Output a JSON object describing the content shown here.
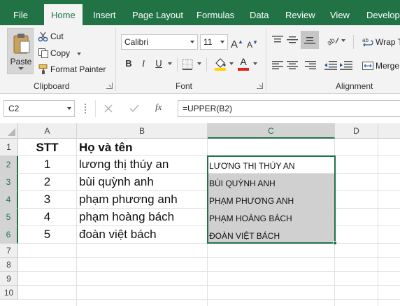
{
  "tabs": [
    {
      "label": "File",
      "active": false
    },
    {
      "label": "Home",
      "active": true
    },
    {
      "label": "Insert",
      "active": false
    },
    {
      "label": "Page Layout",
      "active": false
    },
    {
      "label": "Formulas",
      "active": false
    },
    {
      "label": "Data",
      "active": false
    },
    {
      "label": "Review",
      "active": false
    },
    {
      "label": "View",
      "active": false
    },
    {
      "label": "Develope",
      "active": false
    }
  ],
  "clipboard": {
    "paste_label": "Paste",
    "cut_label": "Cut",
    "copy_label": "Copy",
    "format_painter_label": "Format Painter",
    "group_label": "Clipboard"
  },
  "font": {
    "name": "Calibri",
    "size": "11",
    "group_label": "Font",
    "bold_glyph": "B",
    "italic_glyph": "I",
    "underline_glyph": "U",
    "grow_glyph": "A",
    "shrink_glyph": "A",
    "font_color_glyph": "A",
    "fill_color": "#ffd400",
    "font_color": "#e2231a"
  },
  "alignment": {
    "wrap_label": "Wrap T",
    "merge_label": "Merge",
    "group_label": "Alignment"
  },
  "formula_bar": {
    "name_box": "C2",
    "formula": "=UPPER(B2)",
    "fx_label": "fx"
  },
  "sheet": {
    "columns": [
      "A",
      "B",
      "C",
      "D"
    ],
    "rows": [
      "1",
      "2",
      "3",
      "4",
      "5",
      "6",
      "7",
      "8",
      "9",
      "10"
    ],
    "header_row": {
      "a": "STT",
      "b": "Họ và tên",
      "c": ""
    },
    "data_rows": [
      {
        "a": "1",
        "b": "lương thị thúy an",
        "c": "LƯƠNG THỊ THÚY AN"
      },
      {
        "a": "2",
        "b": "bùi quỳnh anh",
        "c": "BÙI QUỲNH ANH"
      },
      {
        "a": "3",
        "b": "phạm phương anh",
        "c": "PHẠM PHƯƠNG ANH"
      },
      {
        "a": "4",
        "b": "phạm hoàng bách",
        "c": "PHẠM HOÀNG BÁCH"
      },
      {
        "a": "5",
        "b": "đoàn việt bách",
        "c": "ĐOÀN VIỆT BÁCH"
      }
    ],
    "active_cell": "C2",
    "selection": "C2:C6"
  },
  "colors": {
    "accent": "#217346",
    "selection_fill": "#d0d0d0"
  }
}
